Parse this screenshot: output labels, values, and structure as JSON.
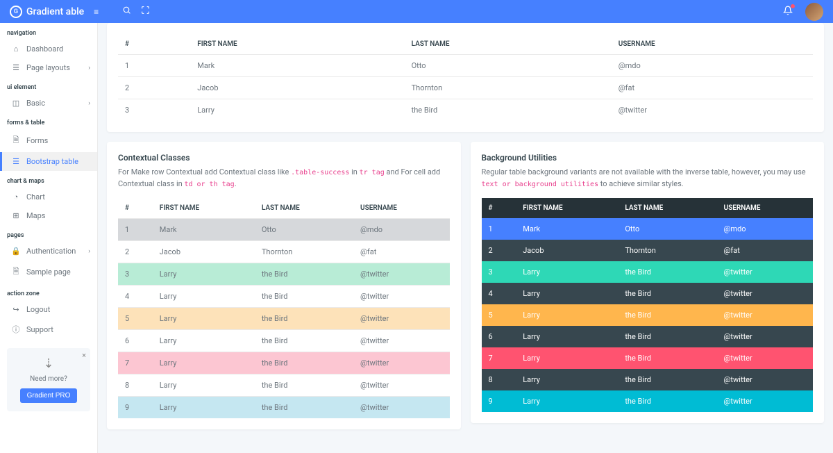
{
  "brand": "Gradient able",
  "sidebar": {
    "sections": [
      {
        "label": "navigation",
        "items": [
          {
            "icon": "⌂",
            "label": "Dashboard",
            "hasChevron": false
          },
          {
            "icon": "☰",
            "label": "Page layouts",
            "hasChevron": true
          }
        ]
      },
      {
        "label": "ui element",
        "items": [
          {
            "icon": "◫",
            "label": "Basic",
            "hasChevron": true
          }
        ]
      },
      {
        "label": "forms & table",
        "items": [
          {
            "icon": "🗎",
            "label": "Forms",
            "hasChevron": false
          },
          {
            "icon": "☰",
            "label": "Bootstrap table",
            "hasChevron": false,
            "active": true
          }
        ]
      },
      {
        "label": "chart & maps",
        "items": [
          {
            "icon": "◔",
            "label": "Chart",
            "hasChevron": false
          },
          {
            "icon": "⊞",
            "label": "Maps",
            "hasChevron": false
          }
        ]
      },
      {
        "label": "pages",
        "items": [
          {
            "icon": "🔒",
            "label": "Authentication",
            "hasChevron": true
          },
          {
            "icon": "🗎",
            "label": "Sample page",
            "hasChevron": false
          }
        ]
      },
      {
        "label": "action zone",
        "items": [
          {
            "icon": "↪",
            "label": "Logout",
            "hasChevron": false
          },
          {
            "icon": "ⓘ",
            "label": "Support",
            "hasChevron": false
          }
        ]
      }
    ],
    "promo": {
      "text": "Need more?",
      "button": "Gradient PRO"
    }
  },
  "table1": {
    "headers": [
      "#",
      "FIRST NAME",
      "LAST NAME",
      "USERNAME"
    ],
    "rows": [
      [
        "1",
        "Mark",
        "Otto",
        "@mdo"
      ],
      [
        "2",
        "Jacob",
        "Thornton",
        "@fat"
      ],
      [
        "3",
        "Larry",
        "the Bird",
        "@twitter"
      ]
    ]
  },
  "card2": {
    "title": "Contextual Classes",
    "desc_parts": [
      "For Make row Contextual add Contextual class like ",
      ".table-success",
      " in ",
      "tr tag",
      " and For cell add Contextual class in ",
      "td or th tag",
      "."
    ],
    "headers": [
      "#",
      "FIRST NAME",
      "LAST NAME",
      "USERNAME"
    ],
    "rows": [
      {
        "cls": "table-active",
        "cells": [
          "1",
          "Mark",
          "Otto",
          "@mdo"
        ]
      },
      {
        "cls": "",
        "cells": [
          "2",
          "Jacob",
          "Thornton",
          "@fat"
        ]
      },
      {
        "cls": "table-success",
        "cells": [
          "3",
          "Larry",
          "the Bird",
          "@twitter"
        ]
      },
      {
        "cls": "",
        "cells": [
          "4",
          "Larry",
          "the Bird",
          "@twitter"
        ]
      },
      {
        "cls": "table-warning",
        "cells": [
          "5",
          "Larry",
          "the Bird",
          "@twitter"
        ]
      },
      {
        "cls": "",
        "cells": [
          "6",
          "Larry",
          "the Bird",
          "@twitter"
        ]
      },
      {
        "cls": "table-danger",
        "cells": [
          "7",
          "Larry",
          "the Bird",
          "@twitter"
        ]
      },
      {
        "cls": "",
        "cells": [
          "8",
          "Larry",
          "the Bird",
          "@twitter"
        ]
      },
      {
        "cls": "table-info",
        "cells": [
          "9",
          "Larry",
          "the Bird",
          "@twitter"
        ]
      }
    ]
  },
  "card3": {
    "title": "Background Utilities",
    "desc_parts": [
      "Regular table background variants are not available with the inverse table, however, you may use ",
      "text or background utilities",
      " to achieve similar styles."
    ],
    "headers": [
      "#",
      "FIRST NAME",
      "LAST NAME",
      "USERNAME"
    ],
    "rows": [
      {
        "cls": "bg-primary",
        "cells": [
          "1",
          "Mark",
          "Otto",
          "@mdo"
        ]
      },
      {
        "cls": "bg-dark",
        "cells": [
          "2",
          "Jacob",
          "Thornton",
          "@fat"
        ]
      },
      {
        "cls": "bg-success",
        "cells": [
          "3",
          "Larry",
          "the Bird",
          "@twitter"
        ]
      },
      {
        "cls": "bg-dark",
        "cells": [
          "4",
          "Larry",
          "the Bird",
          "@twitter"
        ]
      },
      {
        "cls": "bg-warning",
        "cells": [
          "5",
          "Larry",
          "the Bird",
          "@twitter"
        ]
      },
      {
        "cls": "bg-dark",
        "cells": [
          "6",
          "Larry",
          "the Bird",
          "@twitter"
        ]
      },
      {
        "cls": "bg-danger",
        "cells": [
          "7",
          "Larry",
          "the Bird",
          "@twitter"
        ]
      },
      {
        "cls": "bg-dark",
        "cells": [
          "8",
          "Larry",
          "the Bird",
          "@twitter"
        ]
      },
      {
        "cls": "bg-info",
        "cells": [
          "9",
          "Larry",
          "the Bird",
          "@twitter"
        ]
      }
    ]
  }
}
